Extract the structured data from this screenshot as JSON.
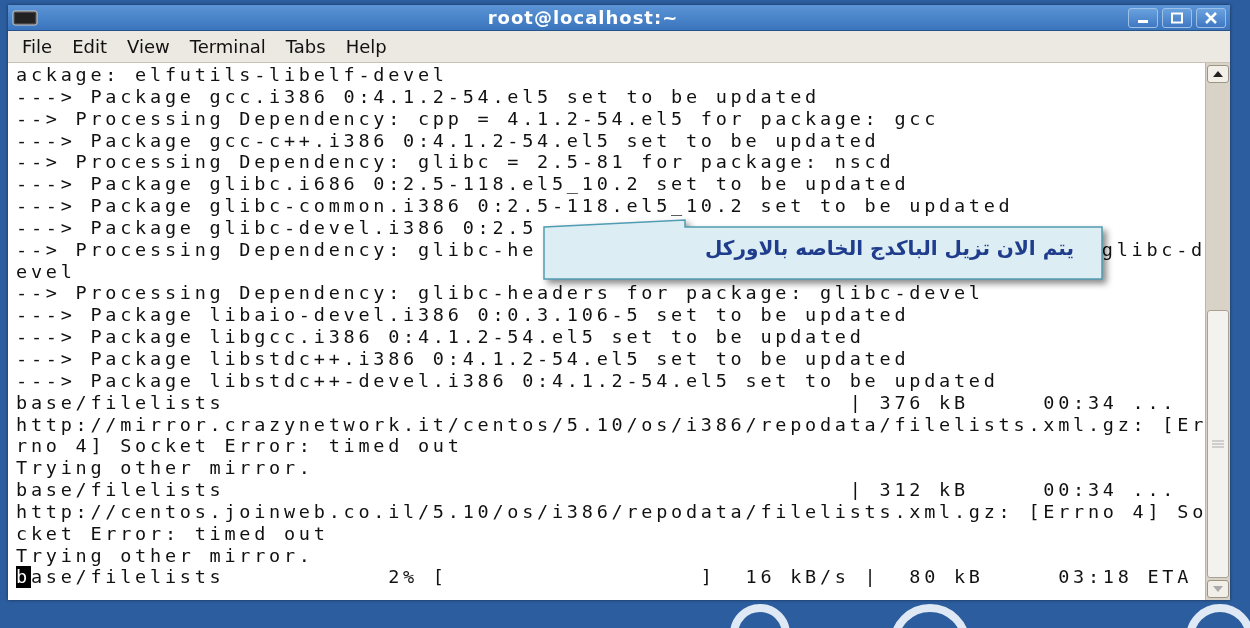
{
  "window": {
    "title": "root@localhost:~"
  },
  "menu": [
    {
      "label": "File"
    },
    {
      "label": "Edit"
    },
    {
      "label": "View"
    },
    {
      "label": "Terminal"
    },
    {
      "label": "Tabs"
    },
    {
      "label": "Help"
    }
  ],
  "terminal": {
    "lines": [
      {
        "text": "ackage: elfutils-libelf-devel"
      },
      {
        "text": "---> Package gcc.i386 0:4.1.2-54.el5 set to be updated"
      },
      {
        "text": "--> Processing Dependency: cpp = 4.1.2-54.el5 for package: gcc"
      },
      {
        "text": "---> Package gcc-c++.i386 0:4.1.2-54.el5 set to be updated"
      },
      {
        "text": "--> Processing Dependency: glibc = 2.5-81 for package: nscd"
      },
      {
        "text": "---> Package glibc.i686 0:2.5-118.el5_10.2 set to be updated"
      },
      {
        "text": "---> Package glibc-common.i386 0:2.5-118.el5_10.2 set to be updated"
      },
      {
        "text": "---> Package glibc-devel.i386 0:2.5"
      },
      {
        "text": "--> Processing Dependency: glibc-he",
        "tail": "glibc-d"
      },
      {
        "text": "evel"
      },
      {
        "text": "--> Processing Dependency: glibc-headers for package: glibc-devel"
      },
      {
        "text": "---> Package libaio-devel.i386 0:0.3.106-5 set to be updated"
      },
      {
        "text": "---> Package libgcc.i386 0:4.1.2-54.el5 set to be updated"
      },
      {
        "text": "---> Package libstdc++.i386 0:4.1.2-54.el5 set to be updated"
      },
      {
        "text": "---> Package libstdc++-devel.i386 0:4.1.2-54.el5 set to be updated"
      },
      {
        "text": "base/filelists                                          | 376 kB     00:34 ..."
      },
      {
        "text": "http://mirror.crazynetwork.it/centos/5.10/os/i386/repodata/filelists.xml.gz: [Er"
      },
      {
        "text": "rno 4] Socket Error: timed out"
      },
      {
        "text": "Trying other mirror."
      },
      {
        "text": "base/filelists                                          | 312 kB     00:34 ..."
      },
      {
        "text": "http://centos.joinweb.co.il/5.10/os/i386/repodata/filelists.xml.gz: [Errno 4] So"
      },
      {
        "text": "cket Error: timed out"
      },
      {
        "text": "Trying other mirror."
      },
      {
        "text": "base/filelists           2% [                 ]  16 kB/s |  80 kB     03:18 ETA",
        "cursor": true
      }
    ]
  },
  "callout": {
    "text": "يتم الان تزيل الباكدج الخاصه بالاوركل"
  }
}
